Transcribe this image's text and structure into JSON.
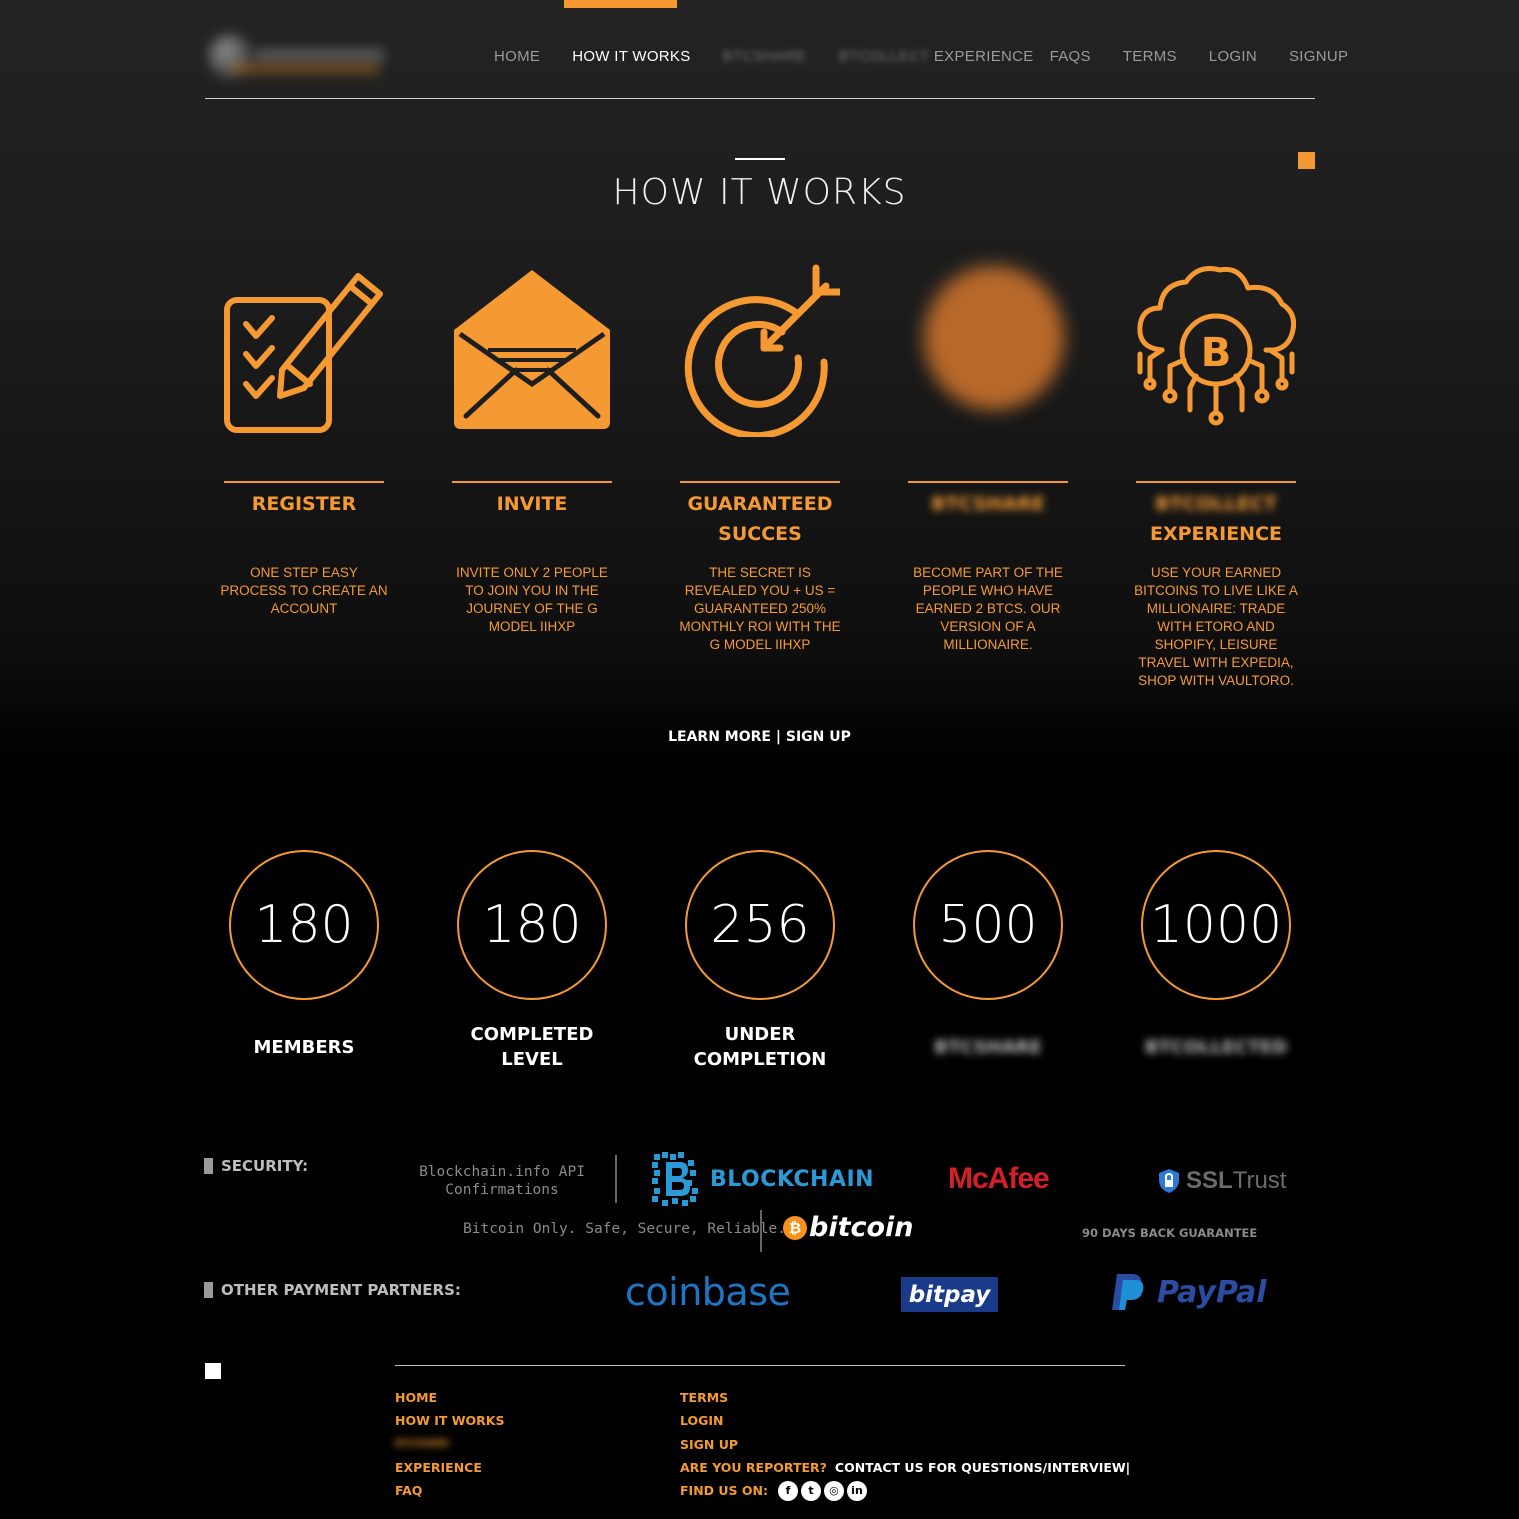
{
  "header": {
    "nav": [
      {
        "label": "HOME",
        "active": false,
        "blurred": false
      },
      {
        "label": "HOW IT WORKS",
        "active": true,
        "blurred": false
      },
      {
        "label": "BTCSHARE",
        "active": false,
        "blurred": true
      },
      {
        "label": "BTCOLLECT",
        "active": false,
        "blurred": true
      },
      {
        "label": "EXPERIENCE",
        "active": false,
        "blurred": false
      },
      {
        "label": "FAQS",
        "active": false,
        "blurred": false
      },
      {
        "label": "TERMS",
        "active": false,
        "blurred": false
      },
      {
        "label": "LOGIN",
        "active": false,
        "blurred": false
      },
      {
        "label": "SIGNUP",
        "active": false,
        "blurred": false
      }
    ]
  },
  "page": {
    "title": "HOW IT WORKS"
  },
  "steps": [
    {
      "name": "REGISTER",
      "desc": "ONE STEP EASY PROCESS TO CREATE AN ACCOUNT",
      "icon": "checklist-pencil-icon"
    },
    {
      "name": "INVITE",
      "desc": "INVITE ONLY 2 PEOPLE TO JOIN YOU IN THE JOURNEY OF THE G MODEL IIHXP",
      "icon": "envelope-icon"
    },
    {
      "name": "GUARANTEED SUCCES",
      "desc": "THE SECRET IS REVEALED YOU + US = GUARANTEED 250% MONTHLY ROI WITH THE G MODEL IIHXP",
      "icon": "target-arrow-icon"
    },
    {
      "name": "BTCSHARE",
      "desc": "BECOME PART OF THE PEOPLE WHO HAVE EARNED 2 BTCS. OUR VERSION OF A MILLIONAIRE.",
      "icon": "blurred-icon"
    },
    {
      "name_blurred": "BTCOLLECT",
      "name": "EXPERIENCE",
      "desc": "USE YOUR EARNED BITCOINS TO LIVE LIKE A MILLIONAIRE: TRADE WITH ETORO AND SHOPIFY, LEISURE TRAVEL WITH EXPEDIA, SHOP WITH VAULTORO.",
      "icon": "bitcoin-cloud-icon"
    }
  ],
  "cta": {
    "learn_more": "LEARN MORE",
    "separator": " | ",
    "sign_up": "SIGN UP"
  },
  "stats": [
    {
      "value": "180",
      "label_line1": "MEMBERS",
      "label_line2": ""
    },
    {
      "value": "180",
      "label_line1": "COMPLETED",
      "label_line2": "LEVEL"
    },
    {
      "value": "256",
      "label_line1": "UNDER",
      "label_line2": "COMPLETION"
    },
    {
      "value": "500",
      "label_line1": "BTCSHARE",
      "label_line2": ""
    },
    {
      "value": "1000",
      "label_line1": "BTCOLLECTED",
      "label_line2": ""
    }
  ],
  "security": {
    "title": "SECURITY:",
    "bc_api_line1": "Blockchain.info API",
    "bc_api_line2": "Confirmations",
    "blockchain": "BLOCKCHAIN",
    "mcafee": "McAfee",
    "ssl_a": "SSL",
    "ssl_b": "Trust",
    "tagline": "Bitcoin Only. Safe, Secure, Reliable.",
    "bitcoin": "bitcoin",
    "guarantee": "90 DAYS BACK GUARANTEE"
  },
  "payment": {
    "title": "OTHER PAYMENT PARTNERS:",
    "coinbase": "coinbase",
    "bitpay": "bitpay",
    "paypal": "PayPal"
  },
  "footer": {
    "col1": [
      "HOME",
      "HOW IT WORKS",
      "BTCSHARE",
      "EXPERIENCE",
      "FAQ"
    ],
    "col2": [
      "TERMS",
      "LOGIN",
      "SIGN UP"
    ],
    "reporter": "ARE YOU REPORTER?",
    "contact": "CONTACT US FOR QUESTIONS/INTERVIEW|",
    "find_us": "FIND US ON:",
    "social": [
      "facebook-icon",
      "twitter-icon",
      "instagram-icon",
      "linkedin-icon"
    ]
  },
  "colors": {
    "accent": "#f59a33",
    "background": "#000000"
  }
}
